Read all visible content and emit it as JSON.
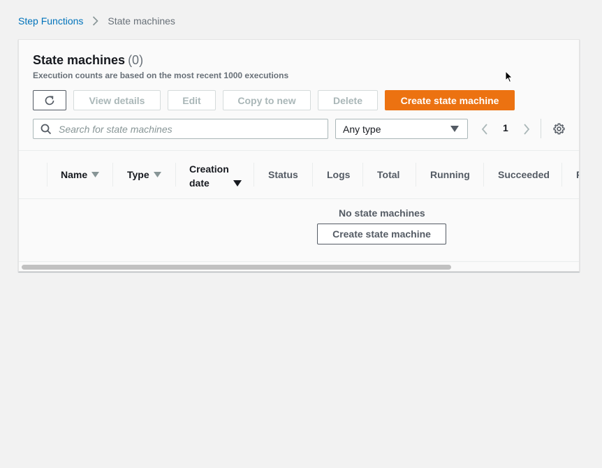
{
  "breadcrumb": {
    "root": "Step Functions",
    "current": "State machines"
  },
  "panel": {
    "title": "State machines",
    "count": "(0)",
    "description": "Execution counts are based on the most recent 1000 executions"
  },
  "toolbar": {
    "refresh_icon": "refresh-icon",
    "view_details": "View details",
    "edit": "Edit",
    "copy_to_new": "Copy to new",
    "delete": "Delete",
    "create": "Create state machine"
  },
  "filters": {
    "search_placeholder": "Search for state machines",
    "type_select": "Any type",
    "page": "1"
  },
  "table": {
    "columns": {
      "name": "Name",
      "type": "Type",
      "creation_line1": "Creation",
      "creation_line2": "date",
      "status": "Status",
      "logs": "Logs",
      "total": "Total",
      "running": "Running",
      "succeeded": "Succeeded",
      "failed_partial": "F"
    },
    "empty_text": "No state machines",
    "empty_button": "Create state machine"
  },
  "colors": {
    "link": "#0073bb",
    "primary": "#ec7211",
    "muted": "#687078"
  }
}
